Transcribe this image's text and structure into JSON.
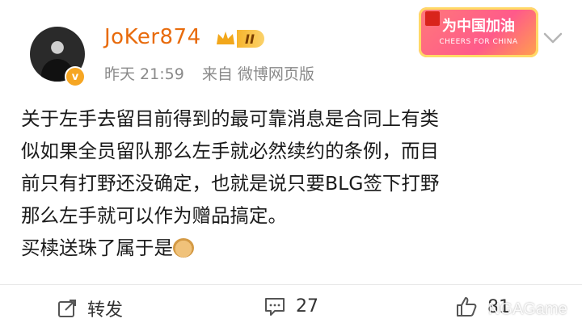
{
  "post": {
    "username": "JoKer874",
    "level": "II",
    "time": "昨天 21:59",
    "source": "来自 微博网页版",
    "lines": [
      "关于左手去留目前得到的最可靠消息是合同上有类",
      "似如果全员留队那么左手就必然续约的条例，而目",
      "前只有打野还没确定，也就是说只要BLG签下打野",
      "那么左手就可以作为赠品搞定。",
      "买椟送珠了属于是"
    ]
  },
  "banner": {
    "title": "为中国加油",
    "subtitle": "CHEERS FOR CHINA"
  },
  "actions": {
    "repost_label": "转发",
    "comment_count": "27",
    "like_count": "81"
  },
  "watermark": "NGAGame",
  "colors": {
    "username": "#e86b0c",
    "meta": "#8a8a8a",
    "badge": "#f7b42c"
  }
}
